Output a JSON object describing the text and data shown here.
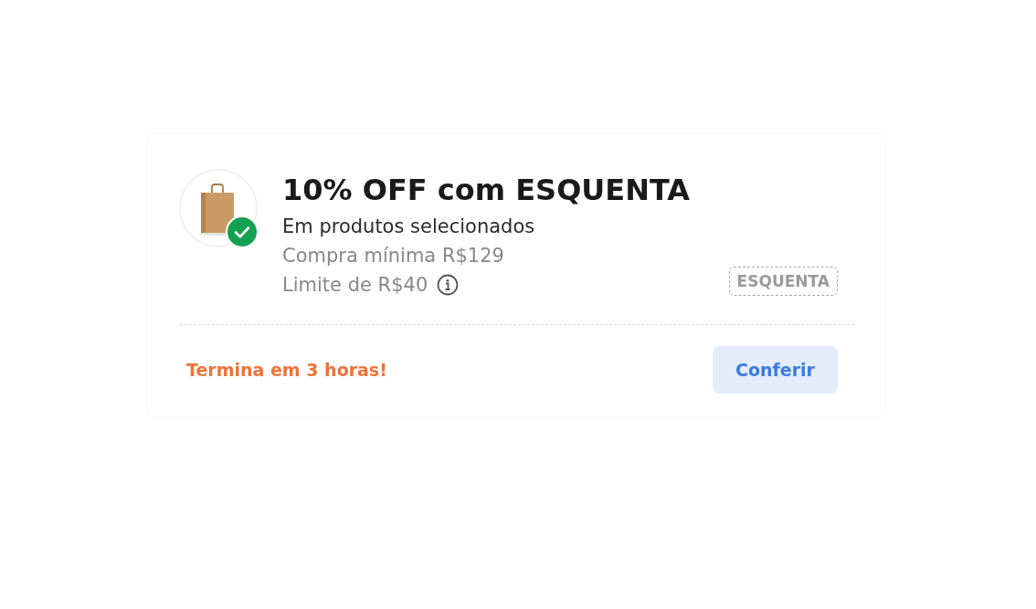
{
  "coupon": {
    "applied": true,
    "title": "10% OFF com ESQUENTA",
    "subtitle": "Em produtos selecionados",
    "conditions": [
      {
        "kind": "text",
        "text": "Compra mínima R$129"
      },
      {
        "kind": "info",
        "text": "Limite de R$40"
      }
    ],
    "code": "ESQUENTA",
    "expiry": "Termina em 3 horas!",
    "button": "Conferir"
  }
}
